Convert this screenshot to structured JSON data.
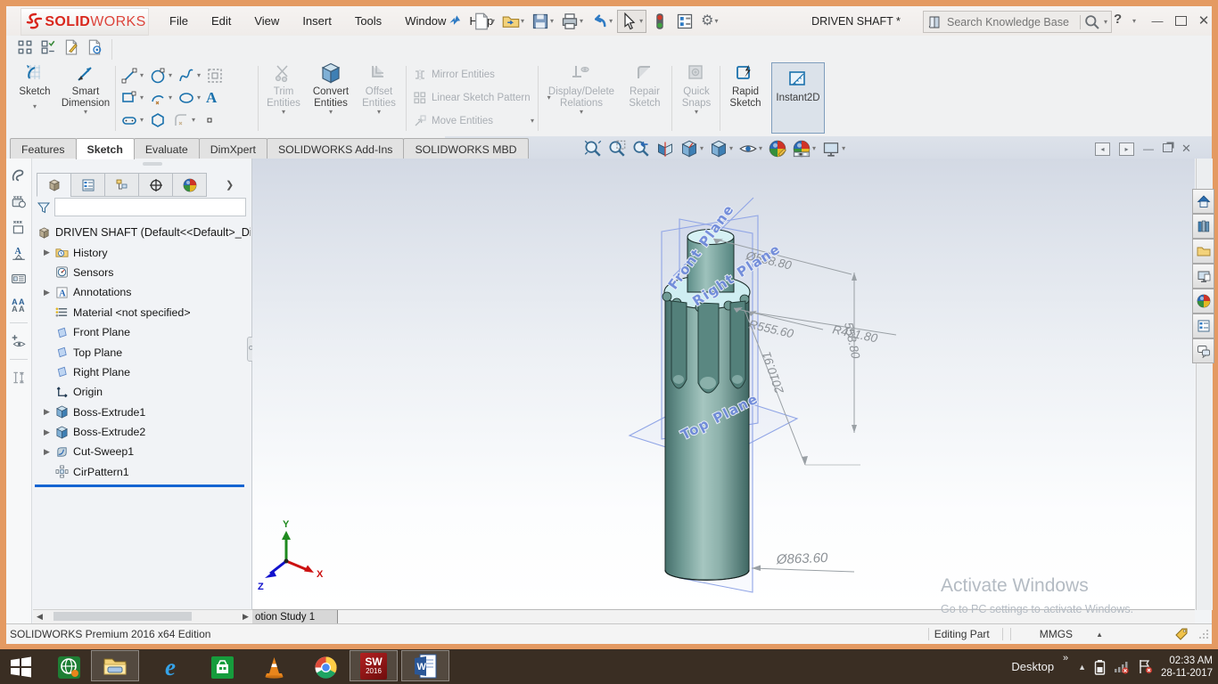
{
  "window": {
    "logo_bold": "SOLID",
    "logo_light": "WORKS",
    "menus": [
      "File",
      "Edit",
      "View",
      "Insert",
      "Tools",
      "Window",
      "Help"
    ],
    "title": "DRIVEN SHAFT *",
    "search_placeholder": "Search Knowledge Base"
  },
  "ribbon": {
    "sketch": "Sketch",
    "smart_dimension": "Smart Dimension",
    "trim": "Trim Entities",
    "convert": "Convert Entities",
    "offset": "Offset Entities",
    "mirror": "Mirror Entities",
    "linear_pattern": "Linear Sketch Pattern",
    "move": "Move Entities",
    "display_delete": "Display/Delete Relations",
    "repair": "Repair Sketch",
    "quick_snaps": "Quick Snaps",
    "rapid_sketch": "Rapid Sketch",
    "instant2d": "Instant2D"
  },
  "tabs": [
    "Features",
    "Sketch",
    "Evaluate",
    "DimXpert",
    "SOLIDWORKS Add-Ins",
    "SOLIDWORKS MBD"
  ],
  "tree": {
    "root": "DRIVEN SHAFT  (Default<<Default>_Dis",
    "items": [
      {
        "label": "History"
      },
      {
        "label": "Sensors"
      },
      {
        "label": "Annotations"
      },
      {
        "label": "Material <not specified>"
      },
      {
        "label": "Front Plane"
      },
      {
        "label": "Top Plane"
      },
      {
        "label": "Right Plane"
      },
      {
        "label": "Origin"
      },
      {
        "label": "Boss-Extrude1"
      },
      {
        "label": "Boss-Extrude2"
      },
      {
        "label": "Cut-Sweep1"
      },
      {
        "label": "CirPattern1"
      }
    ]
  },
  "viewport": {
    "plane_labels": {
      "front": "Front Plane",
      "right": "Right Plane",
      "top": "Top Plane"
    },
    "dimensions": {
      "dia_top": "Ø558.80",
      "len_top": "558.80",
      "r1": "R555.60",
      "r2": "R431.80",
      "len_mid": "2010.91",
      "dia_bottom": "Ø863.60"
    },
    "triad": {
      "x": "X",
      "y": "Y",
      "z": "Z"
    },
    "watermark_line1": "Activate Windows",
    "watermark_line2": "Go to PC settings to activate Windows."
  },
  "bottom": {
    "motion_tab": "otion Study 1"
  },
  "status": {
    "left": "SOLIDWORKS Premium 2016 x64 Edition",
    "editing": "Editing Part",
    "units": "MMGS"
  },
  "taskbar": {
    "desktop": "Desktop",
    "time": "02:33 AM",
    "date": "28-11-2017",
    "ie_label": "e",
    "sw_label": "SW",
    "sw_year": "2016",
    "word_label": "W"
  },
  "colors": {
    "frame": "#e49a62",
    "shaft": "#6f9a94",
    "plane_label": "#6f8ada",
    "logo_red": "#d9261c",
    "taskbar": "#3a2e23"
  }
}
